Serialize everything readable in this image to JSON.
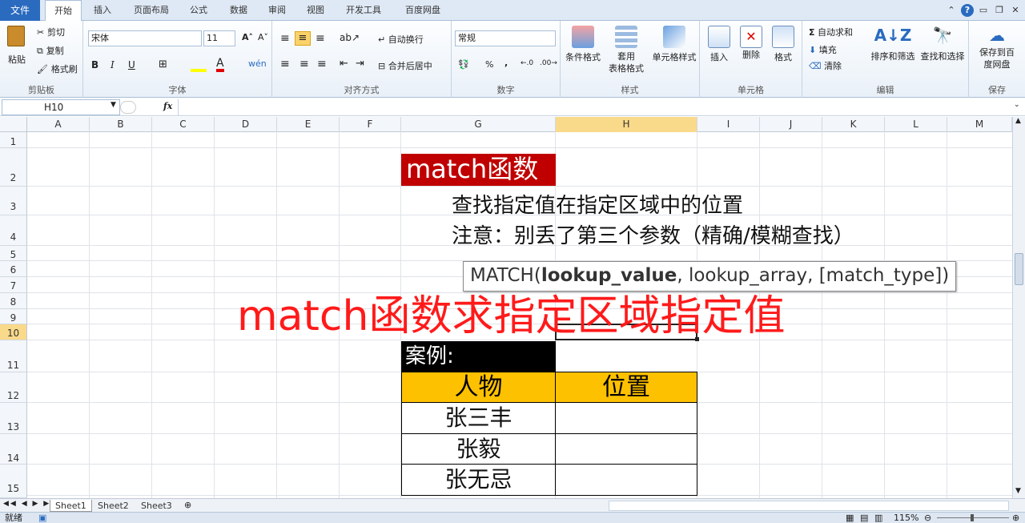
{
  "ribbon_tabs": {
    "file": "文件",
    "items": [
      "开始",
      "插入",
      "页面布局",
      "公式",
      "数据",
      "审阅",
      "视图",
      "开发工具",
      "百度网盘"
    ],
    "active_index": 0
  },
  "clipboard": {
    "paste": "粘贴",
    "cut": "剪切",
    "copy": "复制",
    "format_painter": "格式刷",
    "label": "剪贴板"
  },
  "font": {
    "name": "宋体",
    "size": "11",
    "bold": "B",
    "italic": "I",
    "underline": "U",
    "label": "字体"
  },
  "alignment": {
    "wrap": "自动换行",
    "merge": "合并后居中",
    "label": "对齐方式"
  },
  "number": {
    "format": "常规",
    "percent": "%",
    "comma": ",",
    "label": "数字"
  },
  "styles": {
    "conditional": "条件格式",
    "table_format": "套用\n表格格式",
    "cell_styles": "单元格样式",
    "label": "样式"
  },
  "cells": {
    "insert": "插入",
    "delete": "删除",
    "format": "格式",
    "label": "单元格"
  },
  "editing": {
    "autosum": "自动求和",
    "fill": "填充",
    "clear": "清除",
    "sort_filter": "排序和筛选",
    "find_select": "查找和选择",
    "label": "编辑"
  },
  "save_group": {
    "save_cloud": "保存到百\n度网盘",
    "label": "保存"
  },
  "formula_bar": {
    "name_box": "H10",
    "fx": "fx",
    "formula": ""
  },
  "columns": [
    "A",
    "B",
    "C",
    "D",
    "E",
    "F",
    "G",
    "H",
    "I",
    "J",
    "K",
    "L",
    "M"
  ],
  "selected_column": "H",
  "rows": [
    "1",
    "2",
    "3",
    "4",
    "5",
    "6",
    "7",
    "8",
    "9",
    "10",
    "11",
    "12",
    "13",
    "14",
    "15"
  ],
  "selected_row": "10",
  "content": {
    "title": "match函数",
    "desc1": "查找指定值在指定区域中的位置",
    "desc2": "注意：别丢了第三个参数（精确/模糊查找）",
    "tooltip_prefix": "MATCH(",
    "tooltip_bold": "lookup_value",
    "tooltip_rest": ", lookup_array, [match_type])",
    "overlay": "match函数求指定区域指定值",
    "case_label": "案例:",
    "header_person": "人物",
    "header_position": "位置",
    "people": [
      "张三丰",
      "张毅",
      "张无忌"
    ]
  },
  "sheets": [
    "Sheet1",
    "Sheet2",
    "Sheet3"
  ],
  "active_sheet": "Sheet1",
  "status": {
    "ready": "就绪",
    "zoom": "115%"
  }
}
